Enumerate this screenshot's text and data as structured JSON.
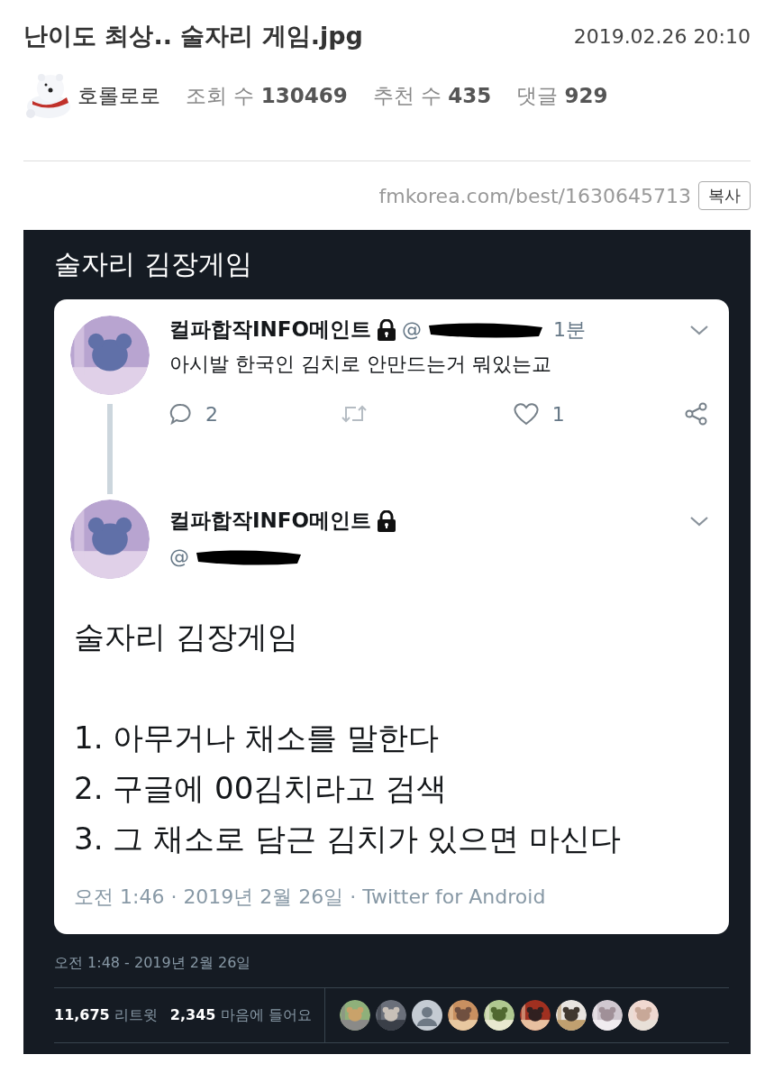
{
  "post": {
    "title": "난이도 최상.. 술자리 게임.jpg",
    "date": "2019.02.26 20:10",
    "author": "호롤로로",
    "stats": [
      {
        "label": "조회 수",
        "value": "130469"
      },
      {
        "label": "추천 수",
        "value": "435"
      },
      {
        "label": "댓글",
        "value": "929"
      }
    ],
    "url": "fmkorea.com/best/1630645713",
    "copy_button": "복사"
  },
  "image": {
    "heading": "술자리 김장게임",
    "reply_tweet": {
      "name": "컬파합작INFO메인트",
      "handle": "@",
      "time": "1분",
      "text": "아시발 한국인 김치로 안만드는거 뭐있는교",
      "actions": [
        {
          "kind": "reply",
          "count": "2"
        },
        {
          "kind": "retweet"
        },
        {
          "kind": "like",
          "count": "1"
        },
        {
          "kind": "share"
        }
      ]
    },
    "main_tweet": {
      "name": "컬파합작INFO메인트",
      "handle": "@",
      "title": "술자리 김장게임",
      "steps": [
        "1. 아무거나 채소를 말한다",
        "2. 구글에 00김치라고 검색",
        "3. 그 채소로 담근 김치가 있으면 마신다"
      ],
      "meta": "오전 1:46 · 2019년 2월 26일 · Twitter for Android"
    },
    "footer_date": "오전 1:48 - 2019년 2월 26일",
    "retweets": {
      "count": "11,675",
      "label": "리트윗"
    },
    "likes": {
      "count": "2,345",
      "label": "마음에 들어요"
    },
    "likers": [
      {
        "kind": "picture"
      },
      {
        "kind": "picture"
      },
      {
        "kind": "default"
      },
      {
        "kind": "picture"
      },
      {
        "kind": "picture"
      },
      {
        "kind": "picture"
      },
      {
        "kind": "picture"
      },
      {
        "kind": "picture"
      },
      {
        "kind": "picture"
      }
    ]
  }
}
